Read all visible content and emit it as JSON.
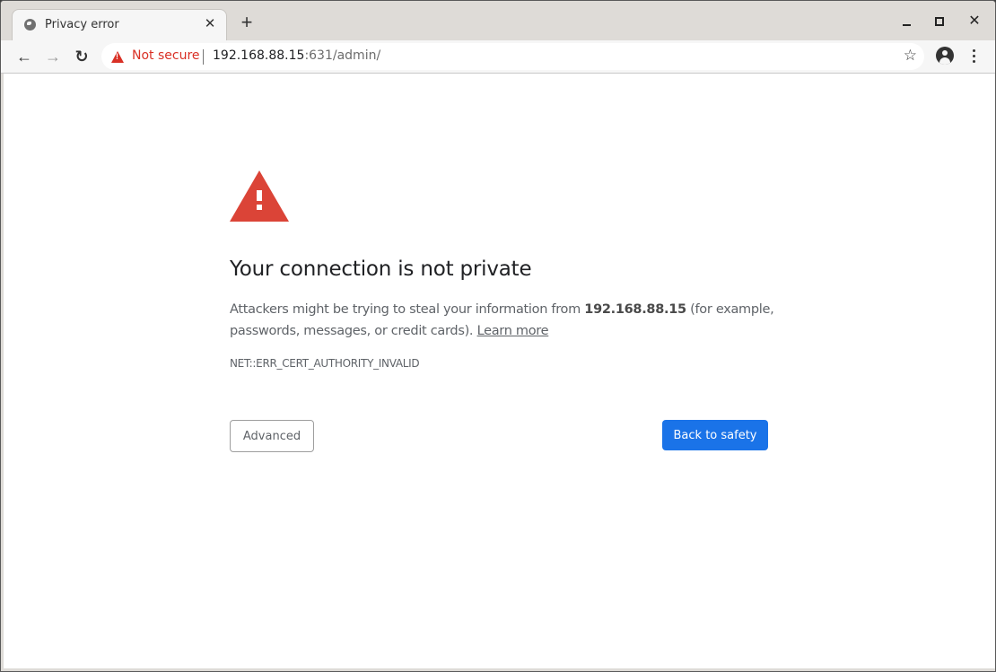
{
  "tab": {
    "title": "Privacy error",
    "close_glyph": "✕",
    "new_tab_glyph": "+"
  },
  "window_controls": {
    "close_glyph": "✕"
  },
  "toolbar": {
    "back_glyph": "←",
    "forward_glyph": "→",
    "reload_glyph": "↻",
    "security_label": "Not secure",
    "url_host": "192.168.88.15",
    "url_path": ":631/admin/",
    "star_glyph": "☆"
  },
  "page": {
    "heading": "Your connection is not private",
    "desc_before": "Attackers might be trying to steal your information from ",
    "desc_host": "192.168.88.15",
    "desc_after": " (for example, passwords, messages, or credit cards). ",
    "learn_more": "Learn more",
    "error_code": "NET::ERR_CERT_AUTHORITY_INVALID",
    "advanced_label": "Advanced",
    "back_to_safety_label": "Back to safety"
  },
  "colors": {
    "warning_red": "#db4437",
    "not_secure_red": "#d93025",
    "primary_blue": "#1a73e8"
  }
}
